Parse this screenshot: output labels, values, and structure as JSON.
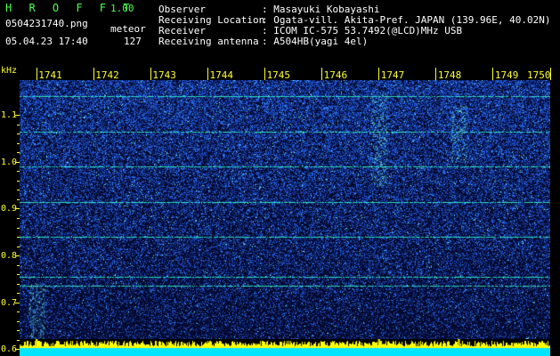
{
  "app": {
    "logo": "H R O F F T",
    "version": "1.00",
    "filename": "0504231740.png",
    "timestamp": "05.04.23 17:40",
    "mode_label": "meteor",
    "count": "127"
  },
  "station": {
    "observer_label": "Observer",
    "observer_value": ": Masayuki Kobayashi",
    "location_label": "Receiving Location",
    "location_value": ": Ogata-vill. Akita-Pref. JAPAN (139.96E, 40.02N)",
    "receiver_label": "Receiver",
    "receiver_value": ": ICOM IC-575 53.7492(@LCD)MHz USB",
    "antenna_label": "Receiving antenna",
    "antenna_value": ": A504HB(yagi 4el)"
  },
  "axes": {
    "unit": "kHz",
    "time_ticks": [
      "1741",
      "1742",
      "1743",
      "1744",
      "1745",
      "1746",
      "1747",
      "1748",
      "1749",
      "1750"
    ],
    "freq_ticks": [
      "1.1",
      "1.0",
      "0.9",
      "0.8",
      "0.7",
      "0.6"
    ]
  },
  "colors": {
    "background": "#000000",
    "axis": "#ffff33",
    "logo": "#4cff4c",
    "spectro_base": "#050a30",
    "noise": "#1e46ff",
    "carrier": "#33ffcc",
    "amplitude": "#00e5ff",
    "amplitude_peak": "#ffff00"
  },
  "spectrogram": {
    "carrier_lines_khz": [
      1.14,
      1.065,
      0.99,
      0.915,
      0.84,
      0.755,
      0.735,
      0.62
    ],
    "meteor_trails": [
      {
        "minute": 1741.0,
        "freq_from": 0.74,
        "freq_to": 0.6
      },
      {
        "minute": 1747.0,
        "freq_from": 1.15,
        "freq_to": 0.95
      },
      {
        "minute": 1748.4,
        "freq_from": 1.12,
        "freq_to": 1.0
      }
    ]
  }
}
